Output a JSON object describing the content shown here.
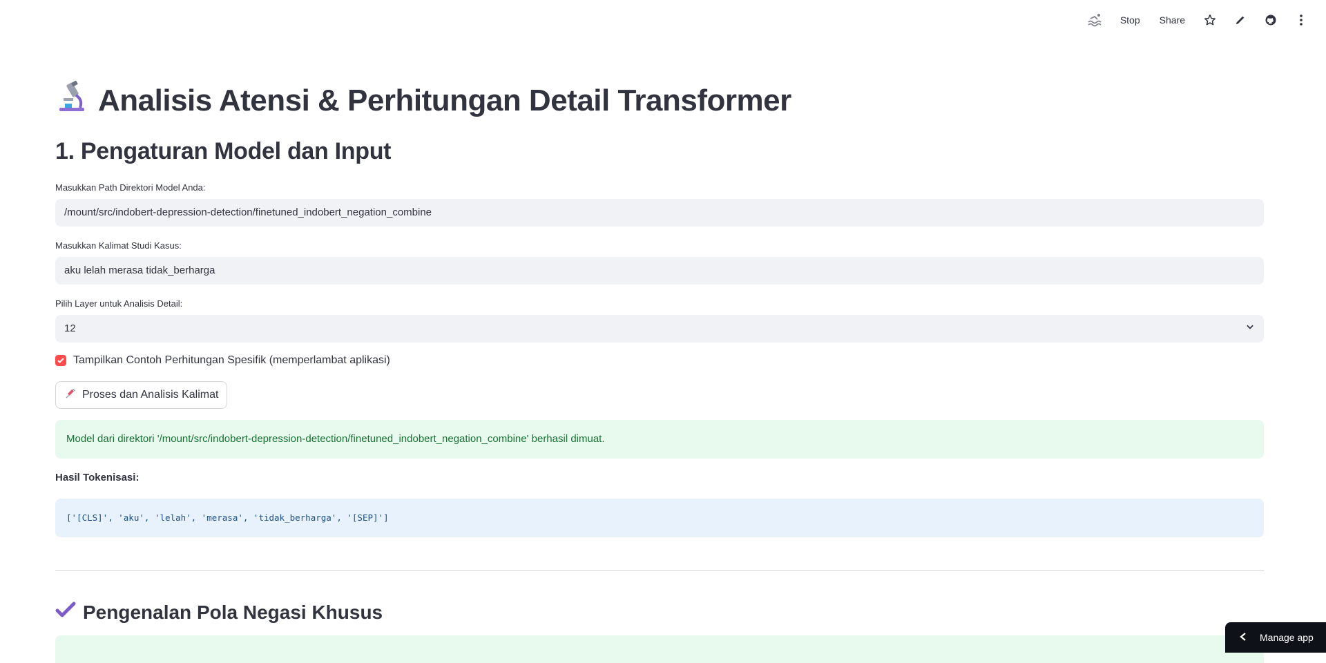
{
  "toolbar": {
    "running_icon": "swimmer-running-icon",
    "stop_label": "Stop",
    "share_label": "Share",
    "star_icon": "star-icon",
    "edit_icon": "pencil-icon",
    "github_icon": "github-icon",
    "menu_icon": "kebab-menu-icon"
  },
  "page": {
    "title_icon": "microscope-icon",
    "title": "Analisis Atensi & Perhitungan Detail Transformer",
    "section1": "1. Pengaturan Model dan Input"
  },
  "form": {
    "model_path_label": "Masukkan Path Direktori Model Anda:",
    "model_path_value": "/mount/src/indobert-depression-detection/finetuned_indobert_negation_combine",
    "sentence_label": "Masukkan Kalimat Studi Kasus:",
    "sentence_value": "aku lelah merasa tidak_berharga",
    "layer_label": "Pilih Layer untuk Analisis Detail:",
    "layer_value": "12",
    "checkbox_label": "Tampilkan Contoh Perhitungan Spesifik (memperlambat aplikasi)",
    "checkbox_checked": true,
    "button_icon": "syringe-icon",
    "button_label": "Proses dan Analisis Kalimat"
  },
  "results": {
    "success_message": "Model dari direktori '/mount/src/indobert-depression-detection/finetuned_indobert_negation_combine' berhasil dimuat.",
    "tokenization_label": "Hasil Tokenisasi:",
    "tokens": "['[CLS]', 'aku', 'lelah', 'merasa', 'tidak_berharga', '[SEP]']",
    "section2_icon": "check-mark-icon",
    "section2_title": "Pengenalan Pola Negasi Khusus"
  },
  "footer": {
    "manage_app_label": "Manage app"
  },
  "colors": {
    "accent": "#ff4b4b",
    "success_bg": "#e8f9ee",
    "success_text": "#177233",
    "info_bg": "#e8f2fd",
    "info_text": "#1c4f8a",
    "input_bg": "#f0f2f6"
  }
}
